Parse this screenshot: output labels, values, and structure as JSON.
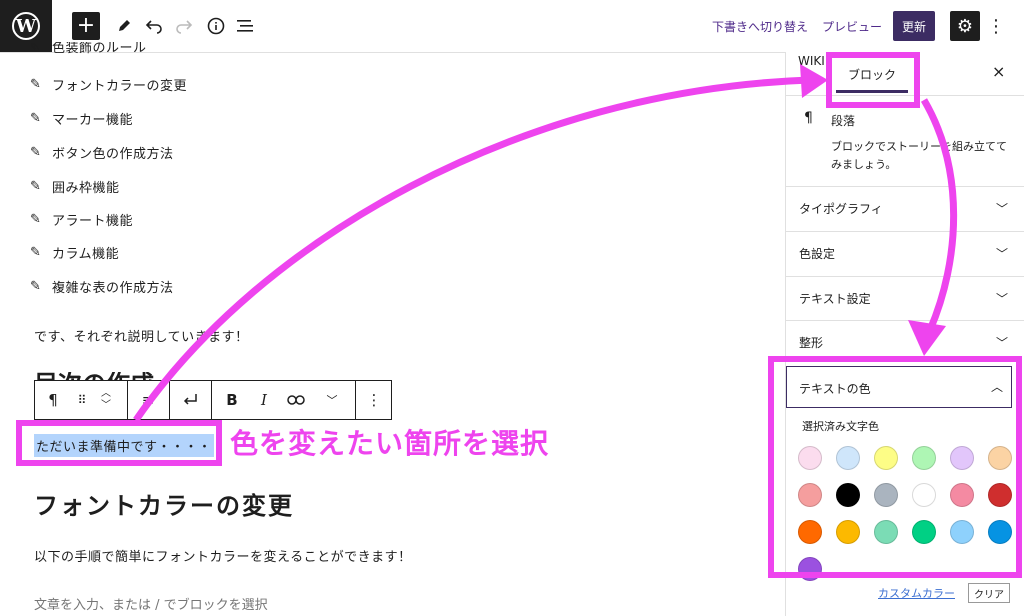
{
  "topbar": {
    "logo": "W",
    "add_label": "+",
    "save_draft": "下書きへ切り替え",
    "preview": "プレビュー",
    "update": "更新",
    "icons": [
      "pencil-icon",
      "undo-icon",
      "redo-icon",
      "info-icon",
      "list-view-icon",
      "gear-icon",
      "more-icon"
    ]
  },
  "content": {
    "partial_item": "色装飾のルール",
    "items": [
      "フォントカラーの変更",
      "マーカー機能",
      "ボタン色の作成方法",
      "囲み枠機能",
      "アラート機能",
      "カラム機能",
      "複雑な表の作成方法"
    ],
    "paragraph": "です、それぞれ説明していきます！",
    "partial_heading": "目次の作成",
    "selected_text": "ただいま準備中です・・・・",
    "heading": "フォントカラーの変更",
    "body": "以下の手順で簡単にフォントカラーを変えることができます！",
    "placeholder": "文章を入力、または / でブロックを選択"
  },
  "block_toolbar": {
    "paragraph_symbol": "¶",
    "drag": "⠿",
    "align": "≡",
    "bold": "B",
    "italic": "I",
    "link_icon": "link-icon",
    "more": "⋮"
  },
  "annotation": {
    "text": "色を変えたい箇所を選択"
  },
  "sidebar": {
    "tab_wiki": "WIKI",
    "tab_block": "ブロック",
    "close": "×",
    "block_icon": "¶",
    "block_name": "段落",
    "block_desc_1": "ブロックでストーリーを組み立てて",
    "block_desc_2": "みましょう。",
    "panels": [
      "タイポグラフィ",
      "色設定",
      "テキスト設定",
      "整形"
    ],
    "text_color_panel": "テキストの色",
    "selected_color_label": "選択済み文字色",
    "custom_color": "カスタムカラー",
    "clear": "クリア",
    "swatches": [
      "#fbdcee",
      "#cfe6fb",
      "#fdfd86",
      "#aef6b4",
      "#e2c6fb",
      "#fbd3a4",
      "#f59e9e",
      "#000000",
      "#aab4bf",
      "#ffffff",
      "#f48aa2",
      "#cf2e2e",
      "#ff6900",
      "#fcb900",
      "#7bdcb5",
      "#00d084",
      "#8ed1fc",
      "#0693e3",
      "#9b51e0"
    ]
  },
  "colors": {
    "accent": "#ee44ee",
    "update_button": "#3c2c63",
    "selection": "#b3d4fc"
  }
}
